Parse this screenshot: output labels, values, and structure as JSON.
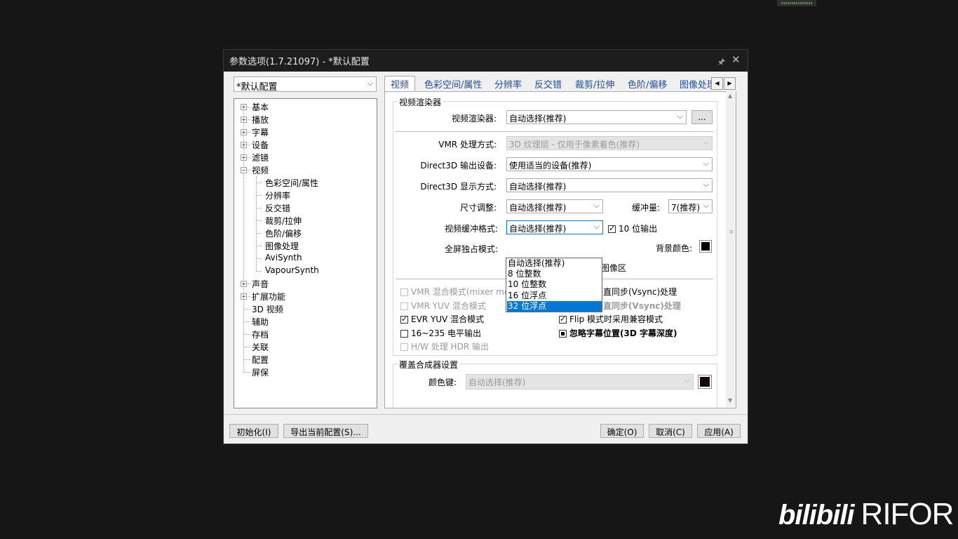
{
  "window": {
    "title": "参数选项(1.7.21097) - *默认配置",
    "pin_glyph": "🖈",
    "close_glyph": "✕"
  },
  "profile_combo": {
    "value": "*默认配置"
  },
  "tree": [
    {
      "label": "基本",
      "expand": "+"
    },
    {
      "label": "播放",
      "expand": "+"
    },
    {
      "label": "字幕",
      "expand": "+"
    },
    {
      "label": "设备",
      "expand": "+"
    },
    {
      "label": "滤镜",
      "expand": "+"
    },
    {
      "label": "视频",
      "expand": "−"
    },
    {
      "label": "色彩空间/属性"
    },
    {
      "label": "分辨率"
    },
    {
      "label": "反交错"
    },
    {
      "label": "裁剪/拉伸"
    },
    {
      "label": "色阶/偏移"
    },
    {
      "label": "图像处理"
    },
    {
      "label": "AviSynth"
    },
    {
      "label": "VapourSynth"
    },
    {
      "label": "声音",
      "expand": "+"
    },
    {
      "label": "扩展功能",
      "expand": "+"
    },
    {
      "label": "3D 视频"
    },
    {
      "label": "辅助"
    },
    {
      "label": "存档"
    },
    {
      "label": "关联"
    },
    {
      "label": "配置"
    },
    {
      "label": "屏保"
    }
  ],
  "tabs": [
    "视频",
    "色彩空间/属性",
    "分辨率",
    "反交错",
    "裁剪/拉伸",
    "色阶/偏移",
    "图像处理"
  ],
  "tab_scroll": {
    "left": "◀",
    "right": "▶"
  },
  "renderer_group": {
    "title": "视频渲染器",
    "video_renderer_label": "视频渲染器:",
    "video_renderer_value": "自动选择(推荐)",
    "ellipsis_button": "...",
    "vmr_label": "VMR 处理方式:",
    "vmr_value": "3D 纹理层 - 仅用于像素着色(推荐)",
    "d3d_device_label": "Direct3D 输出设备:",
    "d3d_device_value": "使用适当的设备(推荐)",
    "d3d_display_label": "Direct3D 显示方式:",
    "d3d_display_value": "自动选择(推荐)",
    "resize_label": "尺寸调整:",
    "resize_value": "自动选择(推荐)",
    "buffer_label": "缓冲量:",
    "buffer_value": "7(推荐)",
    "buffer_format_label": "视频缓冲格式:",
    "buffer_format_value": "自动选择(推荐)",
    "ten_bit_label": "10 位输出",
    "fullscreen_label": "全屏独占模式:",
    "bg_color_label": "背景颜色:",
    "bg_color": "#000000",
    "image_area_partial": "图像区",
    "dropdown_options": [
      "自动选择(推荐)",
      "8 位整数",
      "10 位整数",
      "16 位浮点",
      "32 位浮点"
    ],
    "dropdown_selected": "32 位浮点",
    "options_left": [
      {
        "label": "VMR 混合模式(mixer mode)",
        "state": "unchecked",
        "disabled": true
      },
      {
        "label": "VMR YUV 混合模式",
        "state": "unchecked",
        "disabled": true
      },
      {
        "label": "EVR YUV 混合模式",
        "state": "checked",
        "disabled": false
      },
      {
        "label": "16~235 电平输出",
        "state": "unchecked",
        "disabled": false
      },
      {
        "label": "H/W 处理 HDR 输出",
        "state": "unchecked",
        "disabled": true
      }
    ],
    "options_right": [
      {
        "label": "用新的垂直同步(Vsync)处理",
        "state": "checked",
        "disabled": false,
        "bold": false
      },
      {
        "label": "直接用垂直同步(Vsync)处理",
        "state": "indeterminate",
        "disabled": true,
        "bold": true
      },
      {
        "label": "Flip 模式时采用兼容模式",
        "state": "checked",
        "disabled": false,
        "bold": false
      },
      {
        "label": "忽略字幕位置(3D 字幕深度)",
        "state": "indeterminate",
        "disabled": false,
        "bold": true
      }
    ]
  },
  "overlay_group": {
    "title": "覆盖合成器设置",
    "color_key_label": "颜色键:",
    "color_key_value": "自动选择(推荐)",
    "color_key_color": "#1a0010"
  },
  "footer": {
    "init_button": "初始化(I)",
    "export_button": "导出当前配置(S)...",
    "ok_button": "确定(O)",
    "cancel_button": "取消(C)",
    "apply_button": "应用(A)"
  },
  "watermark": {
    "logo": "bilibili",
    "name": "RIFOR"
  }
}
